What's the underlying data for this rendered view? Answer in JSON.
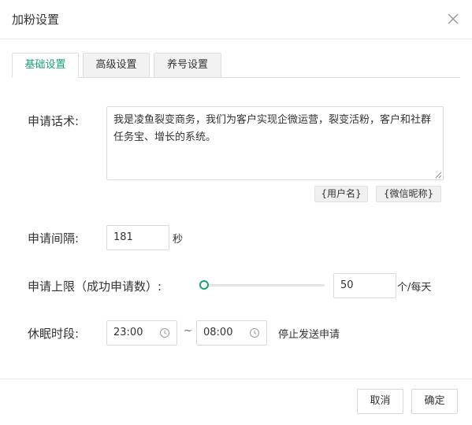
{
  "dialog": {
    "title": "加粉设置",
    "close_icon": "close-icon"
  },
  "tabs": [
    {
      "label": "基础设置",
      "active": true
    },
    {
      "label": "高级设置",
      "active": false
    },
    {
      "label": "养号设置",
      "active": false
    }
  ],
  "form": {
    "greeting": {
      "label": "申请话术:",
      "value": "我是凌鱼裂变商务，我们为客户实现企微运营，裂变活粉，客户和社群任务宝、增长的系统。",
      "tags": [
        "{用户名}",
        "{微信昵称}"
      ]
    },
    "interval": {
      "label": "申请间隔:",
      "value": "181",
      "unit": "秒"
    },
    "limit": {
      "label": "申请上限（成功申请数）:",
      "value": "50",
      "unit": "个/每天",
      "slider_fraction": 0
    },
    "sleep": {
      "label": "休眠时段:",
      "start": "23:00",
      "separator": "~",
      "end": "08:00",
      "note": "停止发送申请"
    }
  },
  "footer": {
    "cancel_label": "取消",
    "ok_label": "确定"
  },
  "colors": {
    "accent": "#1aa179",
    "border": "#d9d9d9"
  }
}
